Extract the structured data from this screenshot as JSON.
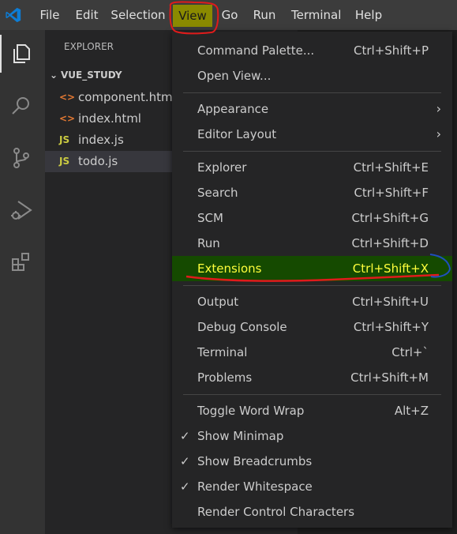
{
  "menubar": {
    "items": [
      "File",
      "Edit",
      "Selection",
      "View",
      "Go",
      "Run",
      "Terminal",
      "Help"
    ],
    "active": "View"
  },
  "sidebar": {
    "title": "EXPLORER",
    "folder": "VUE_STUDY",
    "files": [
      {
        "icon": "<>",
        "name": "component.html",
        "type": "html"
      },
      {
        "icon": "<>",
        "name": "index.html",
        "type": "html"
      },
      {
        "icon": "JS",
        "name": "index.js",
        "type": "js"
      },
      {
        "icon": "JS",
        "name": "todo.js",
        "type": "js",
        "selected": true
      }
    ]
  },
  "view_menu": {
    "groups": [
      [
        {
          "label": "Command Palette...",
          "shortcut": "Ctrl+Shift+P"
        },
        {
          "label": "Open View...",
          "shortcut": ""
        }
      ],
      [
        {
          "label": "Appearance",
          "submenu": true
        },
        {
          "label": "Editor Layout",
          "submenu": true
        }
      ],
      [
        {
          "label": "Explorer",
          "shortcut": "Ctrl+Shift+E"
        },
        {
          "label": "Search",
          "shortcut": "Ctrl+Shift+F"
        },
        {
          "label": "SCM",
          "shortcut": "Ctrl+Shift+G"
        },
        {
          "label": "Run",
          "shortcut": "Ctrl+Shift+D"
        },
        {
          "label": "Extensions",
          "shortcut": "Ctrl+Shift+X",
          "highlighted": true
        }
      ],
      [
        {
          "label": "Output",
          "shortcut": "Ctrl+Shift+U"
        },
        {
          "label": "Debug Console",
          "shortcut": "Ctrl+Shift+Y"
        },
        {
          "label": "Terminal",
          "shortcut": "Ctrl+`"
        },
        {
          "label": "Problems",
          "shortcut": "Ctrl+Shift+M"
        }
      ],
      [
        {
          "label": "Toggle Word Wrap",
          "shortcut": "Alt+Z"
        },
        {
          "label": "Show Minimap",
          "checked": true
        },
        {
          "label": "Show Breadcrumbs",
          "checked": true
        },
        {
          "label": "Render Whitespace",
          "checked": true
        },
        {
          "label": "Render Control Characters"
        }
      ]
    ]
  },
  "activity_icons": [
    "explorer-icon",
    "search-icon",
    "source-control-icon",
    "run-debug-icon",
    "extensions-icon"
  ],
  "colors": {
    "highlight_bg": "#154a00",
    "highlight_text": "#ffff3b",
    "annotation_red": "#e01b1b",
    "active_menu_bg": "#8a8a00"
  }
}
